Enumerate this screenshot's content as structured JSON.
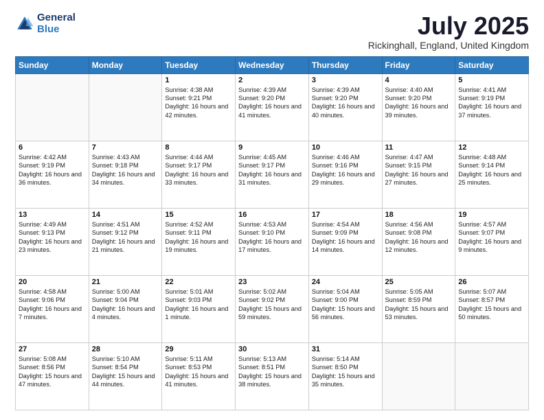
{
  "header": {
    "logo_line1": "General",
    "logo_line2": "Blue",
    "month": "July 2025",
    "location": "Rickinghall, England, United Kingdom"
  },
  "days_of_week": [
    "Sunday",
    "Monday",
    "Tuesday",
    "Wednesday",
    "Thursday",
    "Friday",
    "Saturday"
  ],
  "weeks": [
    [
      {
        "day": "",
        "sunrise": "",
        "sunset": "",
        "daylight": ""
      },
      {
        "day": "",
        "sunrise": "",
        "sunset": "",
        "daylight": ""
      },
      {
        "day": "1",
        "sunrise": "Sunrise: 4:38 AM",
        "sunset": "Sunset: 9:21 PM",
        "daylight": "Daylight: 16 hours and 42 minutes."
      },
      {
        "day": "2",
        "sunrise": "Sunrise: 4:39 AM",
        "sunset": "Sunset: 9:20 PM",
        "daylight": "Daylight: 16 hours and 41 minutes."
      },
      {
        "day": "3",
        "sunrise": "Sunrise: 4:39 AM",
        "sunset": "Sunset: 9:20 PM",
        "daylight": "Daylight: 16 hours and 40 minutes."
      },
      {
        "day": "4",
        "sunrise": "Sunrise: 4:40 AM",
        "sunset": "Sunset: 9:20 PM",
        "daylight": "Daylight: 16 hours and 39 minutes."
      },
      {
        "day": "5",
        "sunrise": "Sunrise: 4:41 AM",
        "sunset": "Sunset: 9:19 PM",
        "daylight": "Daylight: 16 hours and 37 minutes."
      }
    ],
    [
      {
        "day": "6",
        "sunrise": "Sunrise: 4:42 AM",
        "sunset": "Sunset: 9:19 PM",
        "daylight": "Daylight: 16 hours and 36 minutes."
      },
      {
        "day": "7",
        "sunrise": "Sunrise: 4:43 AM",
        "sunset": "Sunset: 9:18 PM",
        "daylight": "Daylight: 16 hours and 34 minutes."
      },
      {
        "day": "8",
        "sunrise": "Sunrise: 4:44 AM",
        "sunset": "Sunset: 9:17 PM",
        "daylight": "Daylight: 16 hours and 33 minutes."
      },
      {
        "day": "9",
        "sunrise": "Sunrise: 4:45 AM",
        "sunset": "Sunset: 9:17 PM",
        "daylight": "Daylight: 16 hours and 31 minutes."
      },
      {
        "day": "10",
        "sunrise": "Sunrise: 4:46 AM",
        "sunset": "Sunset: 9:16 PM",
        "daylight": "Daylight: 16 hours and 29 minutes."
      },
      {
        "day": "11",
        "sunrise": "Sunrise: 4:47 AM",
        "sunset": "Sunset: 9:15 PM",
        "daylight": "Daylight: 16 hours and 27 minutes."
      },
      {
        "day": "12",
        "sunrise": "Sunrise: 4:48 AM",
        "sunset": "Sunset: 9:14 PM",
        "daylight": "Daylight: 16 hours and 25 minutes."
      }
    ],
    [
      {
        "day": "13",
        "sunrise": "Sunrise: 4:49 AM",
        "sunset": "Sunset: 9:13 PM",
        "daylight": "Daylight: 16 hours and 23 minutes."
      },
      {
        "day": "14",
        "sunrise": "Sunrise: 4:51 AM",
        "sunset": "Sunset: 9:12 PM",
        "daylight": "Daylight: 16 hours and 21 minutes."
      },
      {
        "day": "15",
        "sunrise": "Sunrise: 4:52 AM",
        "sunset": "Sunset: 9:11 PM",
        "daylight": "Daylight: 16 hours and 19 minutes."
      },
      {
        "day": "16",
        "sunrise": "Sunrise: 4:53 AM",
        "sunset": "Sunset: 9:10 PM",
        "daylight": "Daylight: 16 hours and 17 minutes."
      },
      {
        "day": "17",
        "sunrise": "Sunrise: 4:54 AM",
        "sunset": "Sunset: 9:09 PM",
        "daylight": "Daylight: 16 hours and 14 minutes."
      },
      {
        "day": "18",
        "sunrise": "Sunrise: 4:56 AM",
        "sunset": "Sunset: 9:08 PM",
        "daylight": "Daylight: 16 hours and 12 minutes."
      },
      {
        "day": "19",
        "sunrise": "Sunrise: 4:57 AM",
        "sunset": "Sunset: 9:07 PM",
        "daylight": "Daylight: 16 hours and 9 minutes."
      }
    ],
    [
      {
        "day": "20",
        "sunrise": "Sunrise: 4:58 AM",
        "sunset": "Sunset: 9:06 PM",
        "daylight": "Daylight: 16 hours and 7 minutes."
      },
      {
        "day": "21",
        "sunrise": "Sunrise: 5:00 AM",
        "sunset": "Sunset: 9:04 PM",
        "daylight": "Daylight: 16 hours and 4 minutes."
      },
      {
        "day": "22",
        "sunrise": "Sunrise: 5:01 AM",
        "sunset": "Sunset: 9:03 PM",
        "daylight": "Daylight: 16 hours and 1 minute."
      },
      {
        "day": "23",
        "sunrise": "Sunrise: 5:02 AM",
        "sunset": "Sunset: 9:02 PM",
        "daylight": "Daylight: 15 hours and 59 minutes."
      },
      {
        "day": "24",
        "sunrise": "Sunrise: 5:04 AM",
        "sunset": "Sunset: 9:00 PM",
        "daylight": "Daylight: 15 hours and 56 minutes."
      },
      {
        "day": "25",
        "sunrise": "Sunrise: 5:05 AM",
        "sunset": "Sunset: 8:59 PM",
        "daylight": "Daylight: 15 hours and 53 minutes."
      },
      {
        "day": "26",
        "sunrise": "Sunrise: 5:07 AM",
        "sunset": "Sunset: 8:57 PM",
        "daylight": "Daylight: 15 hours and 50 minutes."
      }
    ],
    [
      {
        "day": "27",
        "sunrise": "Sunrise: 5:08 AM",
        "sunset": "Sunset: 8:56 PM",
        "daylight": "Daylight: 15 hours and 47 minutes."
      },
      {
        "day": "28",
        "sunrise": "Sunrise: 5:10 AM",
        "sunset": "Sunset: 8:54 PM",
        "daylight": "Daylight: 15 hours and 44 minutes."
      },
      {
        "day": "29",
        "sunrise": "Sunrise: 5:11 AM",
        "sunset": "Sunset: 8:53 PM",
        "daylight": "Daylight: 15 hours and 41 minutes."
      },
      {
        "day": "30",
        "sunrise": "Sunrise: 5:13 AM",
        "sunset": "Sunset: 8:51 PM",
        "daylight": "Daylight: 15 hours and 38 minutes."
      },
      {
        "day": "31",
        "sunrise": "Sunrise: 5:14 AM",
        "sunset": "Sunset: 8:50 PM",
        "daylight": "Daylight: 15 hours and 35 minutes."
      },
      {
        "day": "",
        "sunrise": "",
        "sunset": "",
        "daylight": ""
      },
      {
        "day": "",
        "sunrise": "",
        "sunset": "",
        "daylight": ""
      }
    ]
  ]
}
